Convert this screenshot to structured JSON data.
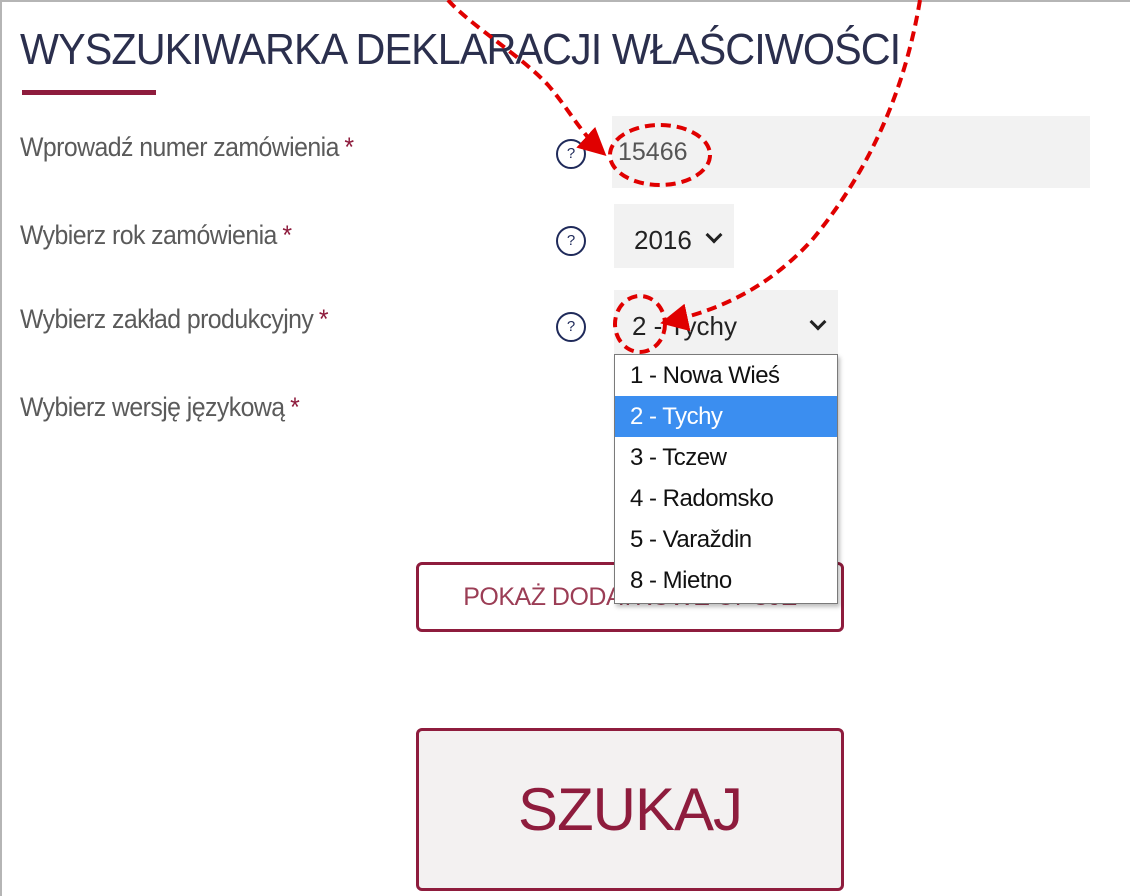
{
  "page": {
    "title": "WYSZUKIWARKA DEKLARACJI WŁAŚCIWOŚCI"
  },
  "form": {
    "order_number": {
      "label": "Wprowadź numer zamówienia",
      "required_mark": "*",
      "help_glyph": "?",
      "value": "15466"
    },
    "order_year": {
      "label": "Wybierz rok zamówienia",
      "required_mark": "*",
      "help_glyph": "?",
      "value": "2016"
    },
    "plant": {
      "label": "Wybierz zakład produkcyjny",
      "required_mark": "*",
      "help_glyph": "?",
      "value": "2 - Tychy",
      "dropdown_open": true,
      "options": [
        {
          "label": "1 - Nowa Wieś",
          "selected": false
        },
        {
          "label": "2 - Tychy",
          "selected": true
        },
        {
          "label": "3 - Tczew",
          "selected": false
        },
        {
          "label": "4 - Radomsko",
          "selected": false
        },
        {
          "label": "5 - Varaždin",
          "selected": false
        },
        {
          "label": "8 - Mietno",
          "selected": false
        }
      ]
    },
    "language": {
      "label": "Wybierz wersję językową",
      "required_mark": "*"
    }
  },
  "buttons": {
    "more_options": "POKAŻ DODATKOWE OPCJE",
    "search": "SZUKAJ"
  },
  "icons": {
    "help": "question-circle-icon",
    "select_arrow": "chevron-down-icon"
  },
  "colors": {
    "title": "#2b2f4d",
    "brand_accent": "#8e1c3d",
    "help_icon": "#1f2a5a",
    "field_background": "#f2f2f2",
    "dropdown_highlight": "#3b8ef0",
    "annotation_red": "#e00000"
  }
}
